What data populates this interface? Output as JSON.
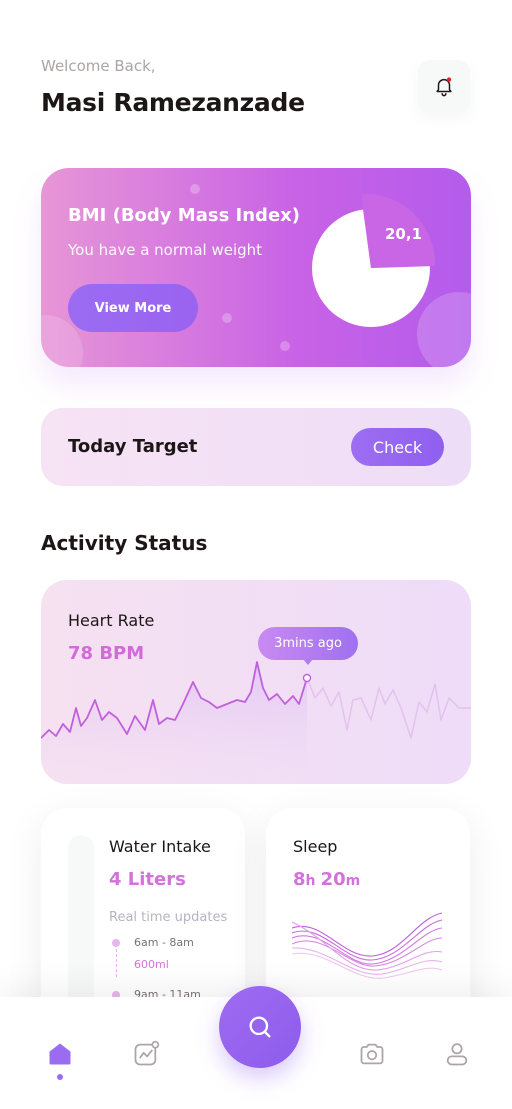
{
  "header": {
    "welcome": "Welcome Back,",
    "username": "Masi Ramezanzade",
    "notification_icon": "bell-icon"
  },
  "bmi": {
    "title": "BMI (Body Mass Index)",
    "subtitle": "You have a normal weight",
    "button_label": "View More",
    "value": "20,1"
  },
  "target": {
    "label": "Today Target",
    "button_label": "Check"
  },
  "activity": {
    "section_title": "Activity Status",
    "heart_rate": {
      "label": "Heart Rate",
      "value": "78 BPM",
      "tooltip": "3mins ago"
    },
    "water": {
      "title": "Water Intake",
      "value": "4 Liters",
      "realtime_label": "Real time updates",
      "items": [
        {
          "time": "6am - 8am",
          "amount": "600ml"
        },
        {
          "time": "9am - 11am"
        }
      ]
    },
    "sleep": {
      "title": "Sleep",
      "hours": "8",
      "hours_unit": "h",
      "minutes": "20",
      "minutes_unit": "m"
    }
  },
  "nav": {
    "items": [
      "home-icon",
      "activity-icon",
      "search-icon",
      "camera-icon",
      "profile-icon"
    ],
    "active": "home"
  },
  "colors": {
    "accent": "#9B6CF2",
    "pink": "#D272DA",
    "text": "#1D1617",
    "grey": "#ADA4A5"
  }
}
